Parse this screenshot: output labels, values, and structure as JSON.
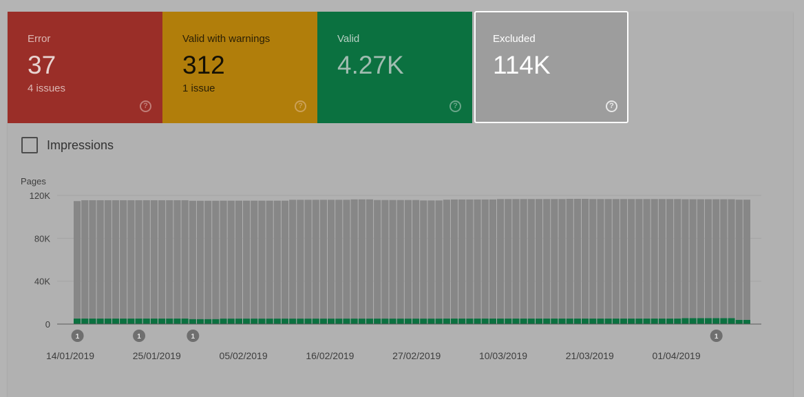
{
  "tiles": [
    {
      "label": "Error",
      "count": "37",
      "sub": "4 issues"
    },
    {
      "label": "Valid with warnings",
      "count": "312",
      "sub": "1 issue"
    },
    {
      "label": "Valid",
      "count": "4.27K",
      "sub": ""
    },
    {
      "label": "Excluded",
      "count": "114K",
      "sub": ""
    }
  ],
  "help_icon_glyph": "?",
  "impressions_label": "Impressions",
  "chart_data": {
    "type": "bar",
    "stacked": true,
    "ylabel": "Pages",
    "ylim": [
      0,
      120000
    ],
    "yticks": [
      "120K",
      "80K",
      "40K",
      "0"
    ],
    "xtick_labels": [
      "14/01/2019",
      "25/01/2019",
      "05/02/2019",
      "16/02/2019",
      "27/02/2019",
      "10/03/2019",
      "21/03/2019",
      "01/04/2019"
    ],
    "annotation_label": "1",
    "annotation_bar_indices": [
      0,
      8,
      15,
      83
    ],
    "series": [
      {
        "name": "Valid",
        "color": "#0b7140",
        "values": [
          5200,
          5200,
          5200,
          5200,
          5200,
          5200,
          5200,
          5200,
          5200,
          5200,
          5200,
          5200,
          5200,
          5200,
          5200,
          4700,
          4700,
          4700,
          4700,
          5100,
          5100,
          5100,
          5100,
          5100,
          5100,
          5100,
          5100,
          5100,
          5100,
          5100,
          5100,
          5100,
          5100,
          5100,
          5100,
          5100,
          5100,
          5100,
          5100,
          5100,
          5100,
          5100,
          5100,
          5100,
          5100,
          5100,
          5100,
          5100,
          5200,
          5200,
          5200,
          5200,
          5200,
          5200,
          5200,
          5200,
          5200,
          5200,
          5200,
          5200,
          5200,
          5200,
          5200,
          5200,
          5200,
          5200,
          5200,
          5200,
          5200,
          5200,
          5200,
          5200,
          5200,
          5200,
          5200,
          5200,
          5200,
          5200,
          5200,
          5600,
          5600,
          5600,
          5600,
          5600,
          5600,
          5600,
          4000,
          4000
        ]
      },
      {
        "name": "Excluded",
        "color": "#878787",
        "values": [
          109500,
          110300,
          110300,
          110300,
          110300,
          110300,
          110300,
          110300,
          110300,
          110300,
          110300,
          110300,
          110300,
          110300,
          110300,
          110300,
          110300,
          110300,
          110300,
          110000,
          110000,
          110000,
          110000,
          110000,
          110000,
          110000,
          110000,
          110000,
          110800,
          110800,
          110800,
          110800,
          110800,
          110800,
          110800,
          110800,
          111200,
          111200,
          111200,
          110600,
          110600,
          110600,
          110600,
          110600,
          110600,
          110200,
          110200,
          110200,
          110800,
          111000,
          111000,
          111000,
          111000,
          111000,
          111000,
          111400,
          111400,
          111400,
          111400,
          111400,
          111400,
          111400,
          111400,
          111400,
          111600,
          111600,
          111600,
          111400,
          111400,
          111400,
          111400,
          111400,
          111400,
          111400,
          111400,
          111400,
          111400,
          111400,
          111400,
          110800,
          110800,
          110800,
          110800,
          110800,
          110800,
          110800,
          112000,
          112000
        ]
      }
    ]
  }
}
